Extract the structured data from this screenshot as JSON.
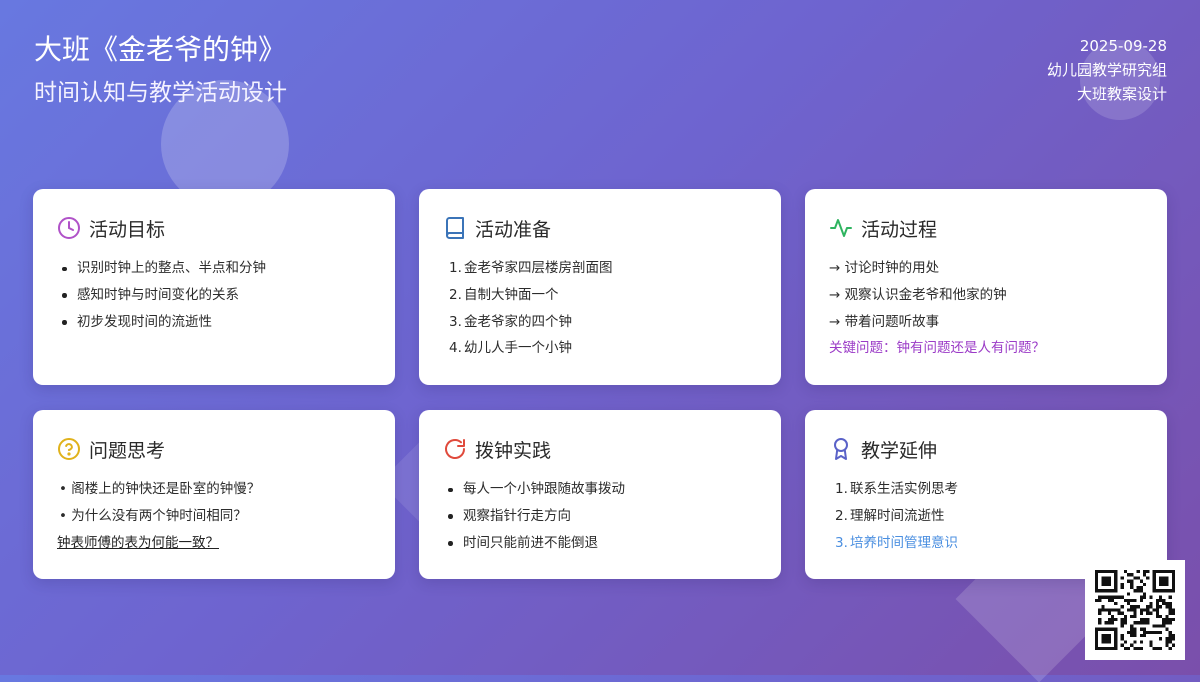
{
  "header": {
    "title": "大班《金老爷的钟》",
    "subtitle": "时间认知与教学活动设计",
    "date": "2025-09-28",
    "org": "幼儿园教学研究组",
    "type": "大班教案设计"
  },
  "colors": {
    "goals_icon": "#b052c8",
    "prep_icon": "#3b74b8",
    "process_icon": "#2fb460",
    "questions_icon": "#e0b21b",
    "practice_icon": "#e04a3c",
    "extension_icon": "#5a62c8",
    "highlight_purple": "#9b3bc7",
    "highlight_blue": "#4b8fe0"
  },
  "cards": {
    "goals": {
      "icon": "clock-icon",
      "title": "活动目标",
      "items": [
        "识别时钟上的整点、半点和分钟",
        "感知时钟与时间变化的关系",
        "初步发现时间的流逝性"
      ]
    },
    "prep": {
      "icon": "book-icon",
      "title": "活动准备",
      "items": [
        {
          "marker": "1.",
          "text": "金老爷家四层楼房剖面图"
        },
        {
          "marker": "2.",
          "text": "自制大钟面一个"
        },
        {
          "marker": "3.",
          "text": "金老爷家的四个钟"
        },
        {
          "marker": "4.",
          "text": "幼儿人手一个小钟"
        }
      ]
    },
    "process": {
      "icon": "activity-icon",
      "title": "活动过程",
      "items": [
        "→ 讨论时钟的用处",
        "→ 观察认识金老爷和他家的钟",
        "→ 带着问题听故事"
      ],
      "key_question": "关键问题：钟有问题还是人有问题？"
    },
    "questions": {
      "icon": "question-circle-icon",
      "title": "问题思考",
      "items": [
        "• 阁楼上的钟快还是卧室的钟慢？",
        "• 为什么没有两个钟时间相同？"
      ],
      "link": "钟表师傅的表为何能一致？"
    },
    "practice": {
      "icon": "rotate-icon",
      "title": "拨钟实践",
      "items": [
        "每人一个小钟跟随故事拨动",
        "观察指针行走方向",
        "时间只能前进不能倒退"
      ]
    },
    "extension": {
      "icon": "award-icon",
      "title": "教学延伸",
      "items": [
        {
          "marker": "1.",
          "text": "联系生活实例思考"
        },
        {
          "marker": "2.",
          "text": "理解时间流逝性"
        }
      ],
      "highlight": {
        "marker": "3.",
        "text": "培养时间管理意识"
      }
    }
  },
  "qr_icon": "qr-code-icon"
}
